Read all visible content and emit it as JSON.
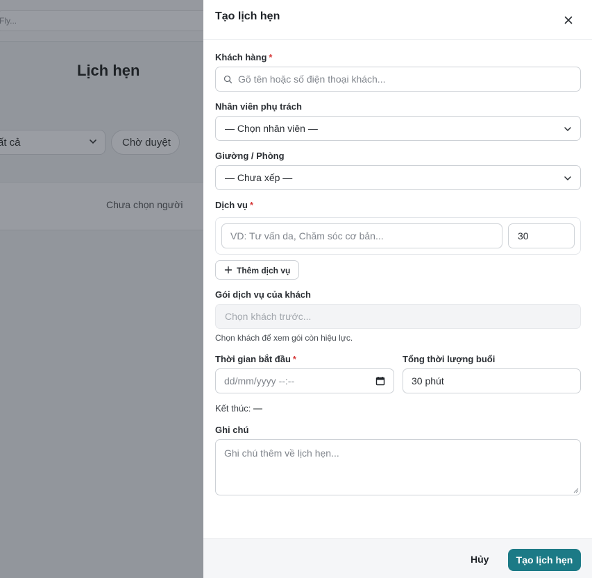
{
  "background": {
    "search_text": "Fly...",
    "page_title": "Lịch hẹn",
    "filter_value": "ất cả",
    "filter_pill": "Chờ duyệt",
    "panel_text": "Chưa chọn người"
  },
  "drawer": {
    "title": "Tạo lịch hẹn",
    "close_icon": "close-icon",
    "customer": {
      "label": "Khách hàng",
      "required": "*",
      "placeholder": "Gõ tên hoặc số điện thoại khách..."
    },
    "staff": {
      "label": "Nhân viên phụ trách",
      "value": "— Chọn nhân viên —"
    },
    "room": {
      "label": "Giường / Phòng",
      "value": "— Chưa xếp —"
    },
    "service": {
      "label": "Dịch vụ",
      "required": "*",
      "name_placeholder": "VD: Tư vấn da, Chăm sóc cơ bản...",
      "duration_value": "30",
      "add_label": "Thêm dịch vụ"
    },
    "package": {
      "label": "Gói dịch vụ của khách",
      "placeholder": "Chọn khách trước...",
      "hint": "Chọn khách để xem gói còn hiệu lực."
    },
    "start_time": {
      "label": "Thời gian bắt đầu",
      "required": "*",
      "placeholder": "dd/mm/yyyy --:--"
    },
    "total_duration": {
      "label": "Tổng thời lượng buổi",
      "value": "30 phút"
    },
    "end": {
      "label": "Kết thúc:",
      "value": "—"
    },
    "note": {
      "label": "Ghi chú",
      "placeholder": "Ghi chú thêm về lịch hẹn..."
    },
    "footer": {
      "cancel_label": "Hủy",
      "submit_label": "Tạo lịch hẹn"
    }
  },
  "colors": {
    "accent": "#1c7a86",
    "required": "#d63a3a",
    "overlay": "#92969c"
  }
}
